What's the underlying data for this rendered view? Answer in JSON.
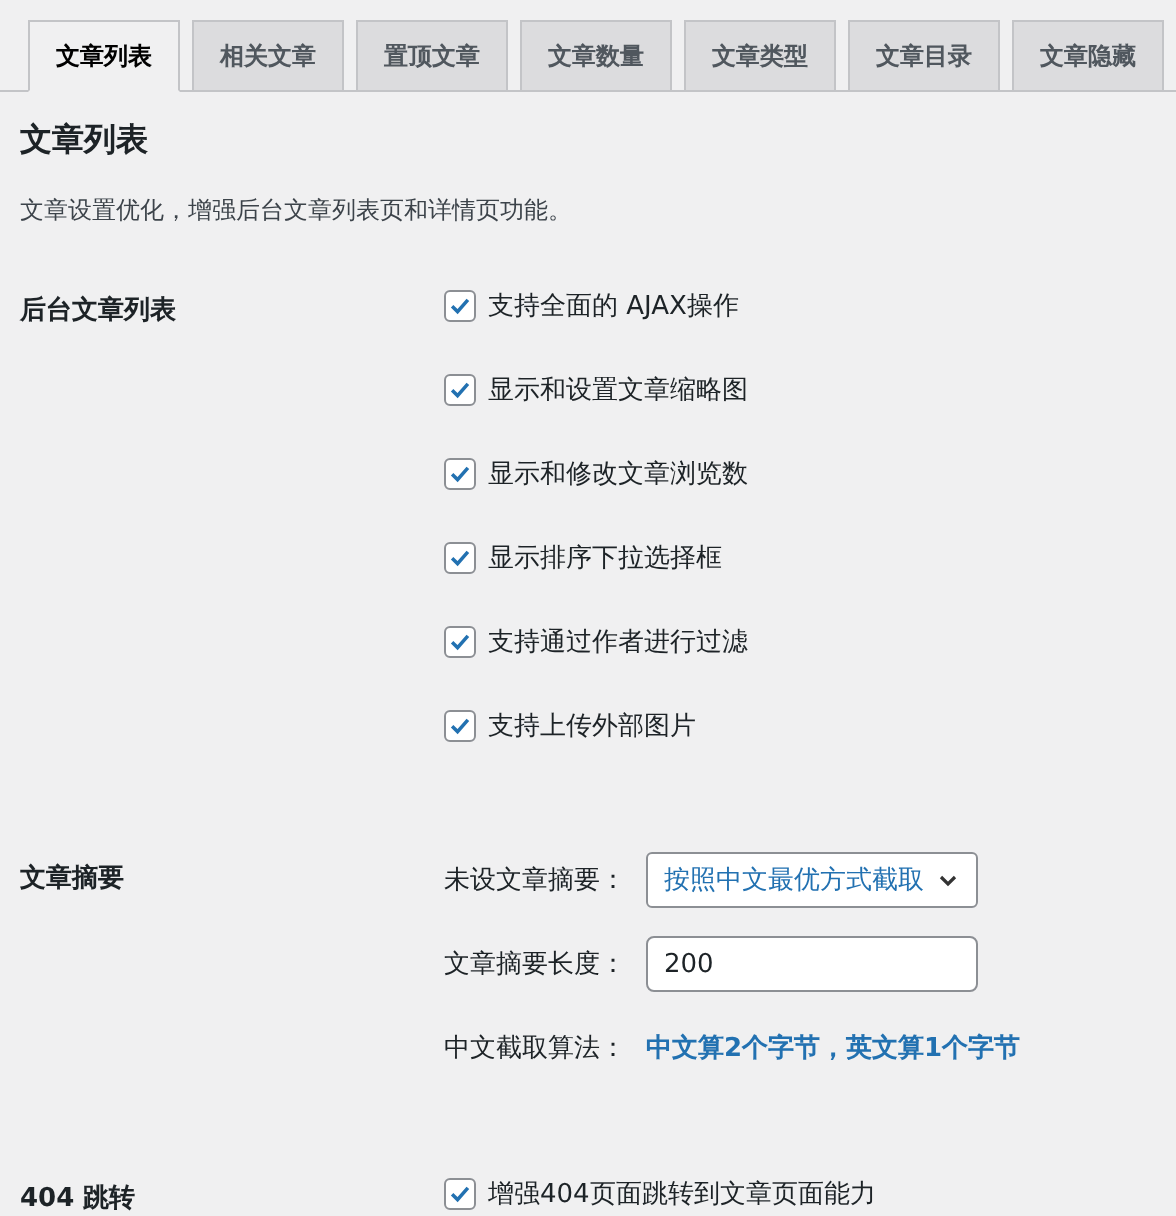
{
  "tabs": [
    {
      "label": "文章列表",
      "selected": true
    },
    {
      "label": "相关文章",
      "selected": false
    },
    {
      "label": "置顶文章",
      "selected": false
    },
    {
      "label": "文章数量",
      "selected": false
    },
    {
      "label": "文章类型",
      "selected": false
    },
    {
      "label": "文章目录",
      "selected": false
    },
    {
      "label": "文章隐藏",
      "selected": false
    }
  ],
  "title": "文章列表",
  "description": "文章设置优化，增强后台文章列表页和详情页功能。",
  "sections": [
    {
      "label": "后台文章列表",
      "kind": "checkboxes",
      "options": [
        {
          "label": "支持全面的 AJAX操作",
          "checked": true
        },
        {
          "label": "显示和设置文章缩略图",
          "checked": true
        },
        {
          "label": "显示和修改文章浏览数",
          "checked": true
        },
        {
          "label": "显示排序下拉选择框",
          "checked": true
        },
        {
          "label": "支持通过作者进行过滤",
          "checked": true
        },
        {
          "label": "支持上传外部图片",
          "checked": true
        }
      ]
    },
    {
      "label": "文章摘要",
      "kind": "fields",
      "fields": [
        {
          "kind": "select",
          "label": "未设文章摘要：",
          "value": "按照中文最优方式截取"
        },
        {
          "kind": "input",
          "label": "文章摘要长度：",
          "value": "200"
        },
        {
          "kind": "info",
          "label": "中文截取算法：",
          "value": "中文算2个字节，英文算1个字节"
        }
      ]
    },
    {
      "label": "404 跳转",
      "kind": "checkboxes",
      "options": [
        {
          "label": "增强404页面跳转到文章页面能力",
          "checked": true
        }
      ]
    }
  ]
}
